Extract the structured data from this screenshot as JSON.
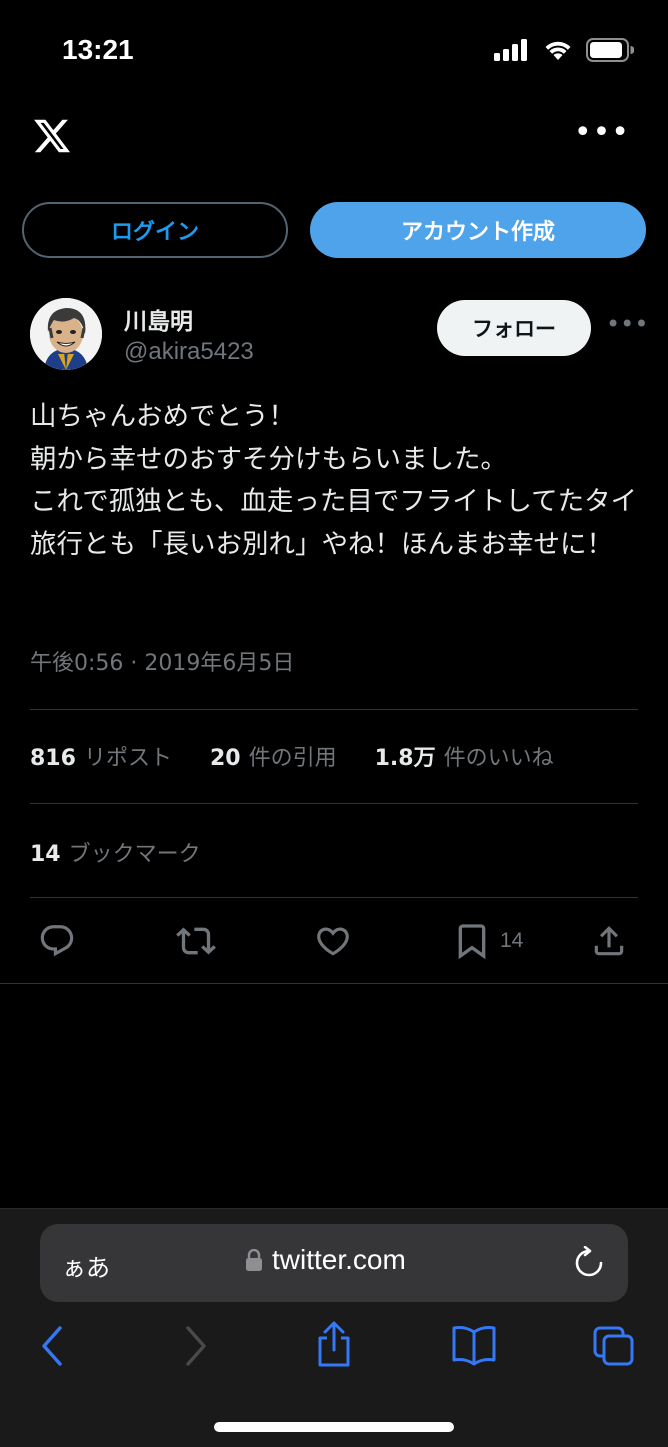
{
  "status_bar": {
    "time": "13:21"
  },
  "buttons": {
    "login": "ログイン",
    "create_account": "アカウント作成",
    "follow": "フォロー"
  },
  "profile": {
    "display_name": "川島明",
    "handle": "@akira5423"
  },
  "tweet": {
    "text": "山ちゃんおめでとう！\n朝から幸せのおすそ分けもらいました。\nこれで孤独とも、血走った目でフライトしてたタイ旅行とも「長いお別れ」やね！ほんまお幸せに！",
    "timestamp": "午後0:56 · 2019年6月5日"
  },
  "stats": {
    "reposts_num": "816",
    "reposts_label": "リポスト",
    "quotes_num": "20",
    "quotes_label": "件の引用",
    "likes_num": "1.8万",
    "likes_label": "件のいいね",
    "bookmarks_num": "14",
    "bookmarks_label": "ブックマーク"
  },
  "actions": {
    "icons": [
      "reply-icon",
      "repost-icon",
      "like-icon",
      "bookmark-icon",
      "share-icon"
    ],
    "bookmark_count": "14"
  },
  "browser": {
    "text_size_label": "ぁあ",
    "url": "twitter.com"
  },
  "colors": {
    "accent": "#1d9bf0",
    "create_button": "#4fa3ea",
    "muted": "#71767b",
    "safari_blue": "#3478f6"
  }
}
